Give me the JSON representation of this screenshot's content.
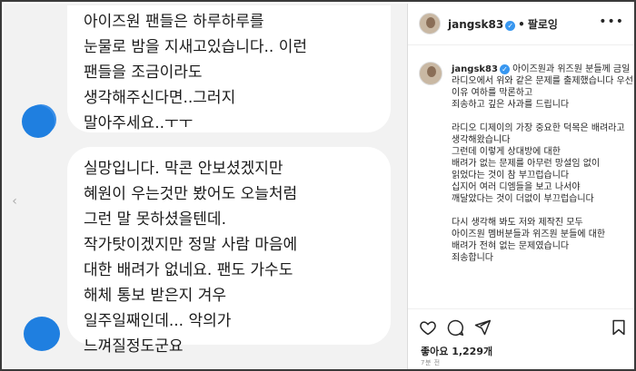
{
  "dm": {
    "message1": "아이즈원 팬들은 하루하루를\n눈물로 밤을 지새고있습니다.. 이런\n팬들을 조금이라도\n생각해주신다면..그러지\n말아주세요..ㅜㅜ",
    "message2": "실망입니다. 막콘 안보셨겠지만\n혜원이 우는것만 봤어도 오늘처럼\n그런 말 못하셨을텐데.\n작가탓이겠지만 정말 사람 마음에\n대한 배려가 없네요. 팬도 가수도\n해체 통보 받은지 겨우\n일주일째인데... 악의가\n느껴질정도군요"
  },
  "post": {
    "username": "jangsk83",
    "verified_glyph": "✓",
    "separator": "•",
    "follow_label": "팔로잉",
    "more_glyph": "•••",
    "caption": "아이즈원과 위즈원 분들께 금일 라디오에서 위와 같은 문제를 출제했습니다 우선 이유 여하를 막론하고\n죄송하고 깊은 사과를 드립니다\n\n라디오 디제이의 가장 중요한 덕목은 배려라고 생각해왔습니다\n그런데 이렇게 상대방에 대한\n배려가 없는 문제를 아무런 망설임 없이\n읽었다는 것이 참 부끄럽습니다\n십지어 여러 디엠들을 보고 나서야\n깨달았다는 것이 더없이 부끄럽습니다\n\n다시 생각해 봐도 저와 제작진 모두\n아이즈원 멤버분들과 위즈원 분들에 대한\n배려가 전혀 없는 문제였습니다\n죄송합니다",
    "likes": "좋아요 1,229개",
    "time": "7분 전"
  },
  "colors": {
    "dm_background": "#f2f2f2",
    "bubble": "#ffffff",
    "avatar_blue": "#1f7fe0",
    "verified": "#3897f0"
  },
  "icons": [
    "heart-icon",
    "comment-icon",
    "share-icon",
    "bookmark-icon",
    "more-icon",
    "chevron-left-icon"
  ]
}
